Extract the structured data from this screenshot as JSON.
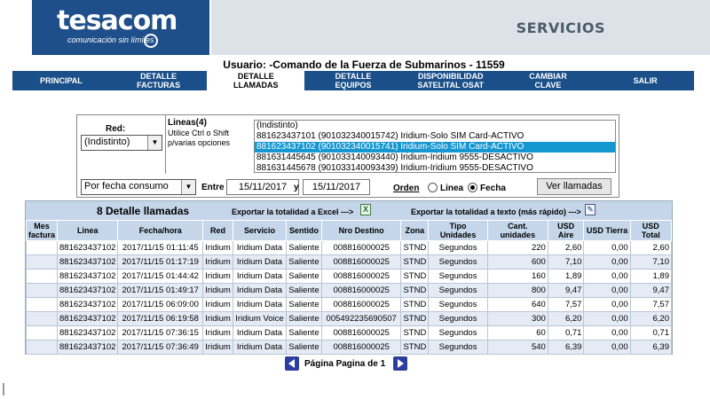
{
  "header": {
    "logo_text": "tesacom",
    "logo_tagline": "comunicación sin límites",
    "section_title": "SERVICIOS"
  },
  "user_line": "Usuario: -Comando de la Fuerza de Submarinos - 11559",
  "nav": {
    "tabs": [
      {
        "label": "PRINCIPAL"
      },
      {
        "label": "DETALLE\nFACTURAS"
      },
      {
        "label": "DETALLE\nLLAMADAS",
        "active": true
      },
      {
        "label": "DETALLE\nEQUIPOS"
      },
      {
        "label": "DISPONIBILIDAD\nSATELITAL OSAT"
      },
      {
        "label": "CAMBIAR\nCLAVE"
      },
      {
        "label": "SALIR"
      }
    ]
  },
  "filter": {
    "red_label": "Red:",
    "red_value": "(Indistinto)",
    "lineas_title": "Lineas(4)",
    "lineas_help": "Utilice Ctrl o Shift\np/varias opciones",
    "lineas_options": [
      "(Indistinto)",
      "881623437101 (901032340015742) Iridium-Solo SIM Card-ACTIVO",
      "881623437102 (901032340015741) Iridium-Solo SIM Card-ACTIVO",
      "881631445645 (901033140093440) Iridium-Iridium 9555-DESACTIVO",
      "881631445678 (901033140093439) Iridium-Iridium 9555-DESACTIVO"
    ],
    "lineas_selected_index": 2,
    "order_value": "Por fecha consumo",
    "entre_label": "Entre",
    "date_from": "15/11/2017",
    "y_label": "y",
    "date_to": "15/11/2017",
    "orden_label": "Orden",
    "radio_linea": "Linea",
    "radio_fecha": "Fecha",
    "radio_selected": "Fecha",
    "button_label": "Ver llamadas"
  },
  "results": {
    "title": "8 Detalle llamadas",
    "export_excel": "Exportar la totalidad a Excel --->",
    "export_text": "Exportar la totalidad a texto (más rápido) --->",
    "columns": [
      "Mes factura",
      "Linea",
      "Fecha/hora",
      "Red",
      "Servicio",
      "Sentido",
      "Nro Destino",
      "Zona",
      "Tipo Unidades",
      "Cant. unidades",
      "USD Aire",
      "USD Tierra",
      "USD Total"
    ],
    "rows": [
      [
        "",
        "881623437102",
        "2017/11/15 01:11:45",
        "Iridium",
        "Iridium Data",
        "Saliente",
        "008816000025",
        "STND",
        "Segundos",
        "220",
        "2,60",
        "0,00",
        "2,60"
      ],
      [
        "",
        "881623437102",
        "2017/11/15 01:17:19",
        "Iridium",
        "Iridium Data",
        "Saliente",
        "008816000025",
        "STND",
        "Segundos",
        "600",
        "7,10",
        "0,00",
        "7,10"
      ],
      [
        "",
        "881623437102",
        "2017/11/15 01:44:42",
        "Iridium",
        "Iridium Data",
        "Saliente",
        "008816000025",
        "STND",
        "Segundos",
        "160",
        "1,89",
        "0,00",
        "1,89"
      ],
      [
        "",
        "881623437102",
        "2017/11/15 01:49:17",
        "Iridium",
        "Iridium Data",
        "Saliente",
        "008816000025",
        "STND",
        "Segundos",
        "800",
        "9,47",
        "0,00",
        "9,47"
      ],
      [
        "",
        "881623437102",
        "2017/11/15 06:09:00",
        "Iridium",
        "Iridium Data",
        "Saliente",
        "008816000025",
        "STND",
        "Segundos",
        "640",
        "7,57",
        "0,00",
        "7,57"
      ],
      [
        "",
        "881623437102",
        "2017/11/15 06:19:58",
        "Iridium",
        "Iridium Voice",
        "Saliente",
        "005492235690507",
        "STND",
        "Segundos",
        "300",
        "6,20",
        "0,00",
        "6,20"
      ],
      [
        "",
        "881623437102",
        "2017/11/15 07:36:15",
        "Iridium",
        "Iridium Data",
        "Saliente",
        "008816000025",
        "STND",
        "Segundos",
        "60",
        "0,71",
        "0,00",
        "0,71"
      ],
      [
        "",
        "881623437102",
        "2017/11/15 07:36:49",
        "Iridium",
        "Iridium Data",
        "Saliente",
        "008816000025",
        "STND",
        "Segundos",
        "540",
        "6,39",
        "0,00",
        "6,39"
      ]
    ]
  },
  "pager": {
    "label": "Página Pagina de 1"
  },
  "colors": {
    "brand_blue": "#1f4f8a",
    "nav_blue": "#1a4f89",
    "table_header": "#c6d6ea",
    "row_alt": "#e4ebf5",
    "selected_option": "#1597d2"
  },
  "icons": {
    "excel": "excel-icon",
    "text_file": "text-file-icon",
    "prev": "arrow-left-icon",
    "next": "arrow-right-icon"
  }
}
